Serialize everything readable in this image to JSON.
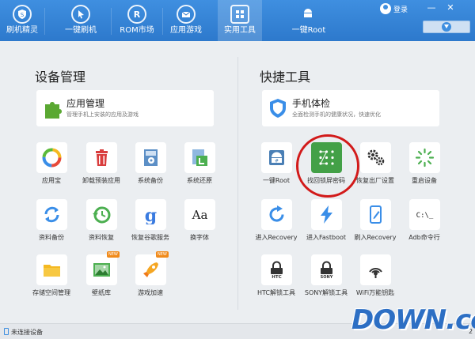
{
  "colors": {
    "accent": "#2d79cc",
    "highlight_ring": "#d21a1a",
    "badge": "#f08a1a"
  },
  "nav": {
    "items": [
      {
        "label": "刷机精灵",
        "icon": "shield-s-icon",
        "active": false
      },
      {
        "label": "一键刷机",
        "icon": "cursor-icon",
        "active": false
      },
      {
        "label": "ROM市场",
        "icon": "rom-r-icon",
        "active": false
      },
      {
        "label": "应用游戏",
        "icon": "mail-bag-icon",
        "active": false
      },
      {
        "label": "实用工具",
        "icon": "grid-icon",
        "active": true
      },
      {
        "label": "一键Root",
        "icon": "android-icon",
        "active": false
      }
    ],
    "login_label": "登录",
    "minimize_label": "—",
    "close_label": "✕"
  },
  "left": {
    "title": "设备管理",
    "card": {
      "title": "应用管理",
      "desc": "管理手机上安装的应用及游戏"
    },
    "tools": [
      {
        "label": "应用宝",
        "icon": "app-store-icon"
      },
      {
        "label": "卸载预装应用",
        "icon": "trash-icon"
      },
      {
        "label": "系统备份",
        "icon": "system-backup-icon"
      },
      {
        "label": "系统还原",
        "icon": "system-restore-icon"
      },
      {
        "label": "资料备份",
        "icon": "sync-icon"
      },
      {
        "label": "资料恢复",
        "icon": "clock-restore-icon"
      },
      {
        "label": "恢复谷歌服务",
        "icon": "google-icon"
      },
      {
        "label": "换字体",
        "icon": "font-icon",
        "glyph": "Aa"
      },
      {
        "label": "存储空间管理",
        "icon": "folder-icon"
      },
      {
        "label": "壁纸库",
        "icon": "wallpaper-icon",
        "badge": "NEW"
      },
      {
        "label": "游戏加速",
        "icon": "rocket-icon",
        "badge": "NEW"
      }
    ]
  },
  "right": {
    "title": "快捷工具",
    "card": {
      "title": "手机体检",
      "desc": "全面检测手机的健康状况，快速优化"
    },
    "tools": [
      {
        "label": "一键Root",
        "icon": "android-root-icon"
      },
      {
        "label": "找回锁屏密码",
        "icon": "pattern-lock-icon"
      },
      {
        "label": "恢复出厂设置",
        "icon": "gears-icon"
      },
      {
        "label": "重启设备",
        "icon": "loading-icon"
      },
      {
        "label": "进入Recovery",
        "icon": "refresh-icon"
      },
      {
        "label": "进入Fastboot",
        "icon": "lightning-icon"
      },
      {
        "label": "刷入Recovery",
        "icon": "phone-edit-icon"
      },
      {
        "label": "Adb命令行",
        "icon": "terminal-icon",
        "glyph": "C:\\_"
      },
      {
        "label": "HTC解锁工具",
        "icon": "htc-lock-icon",
        "glyph": "HTC"
      },
      {
        "label": "SONY解锁工具",
        "icon": "sony-lock-icon",
        "glyph": "SONY"
      },
      {
        "label": "WiFi万能钥匙",
        "icon": "wifi-key-icon"
      }
    ]
  },
  "status": {
    "text": "未连接设备",
    "version": "2"
  },
  "watermark": "DOWN.cc"
}
